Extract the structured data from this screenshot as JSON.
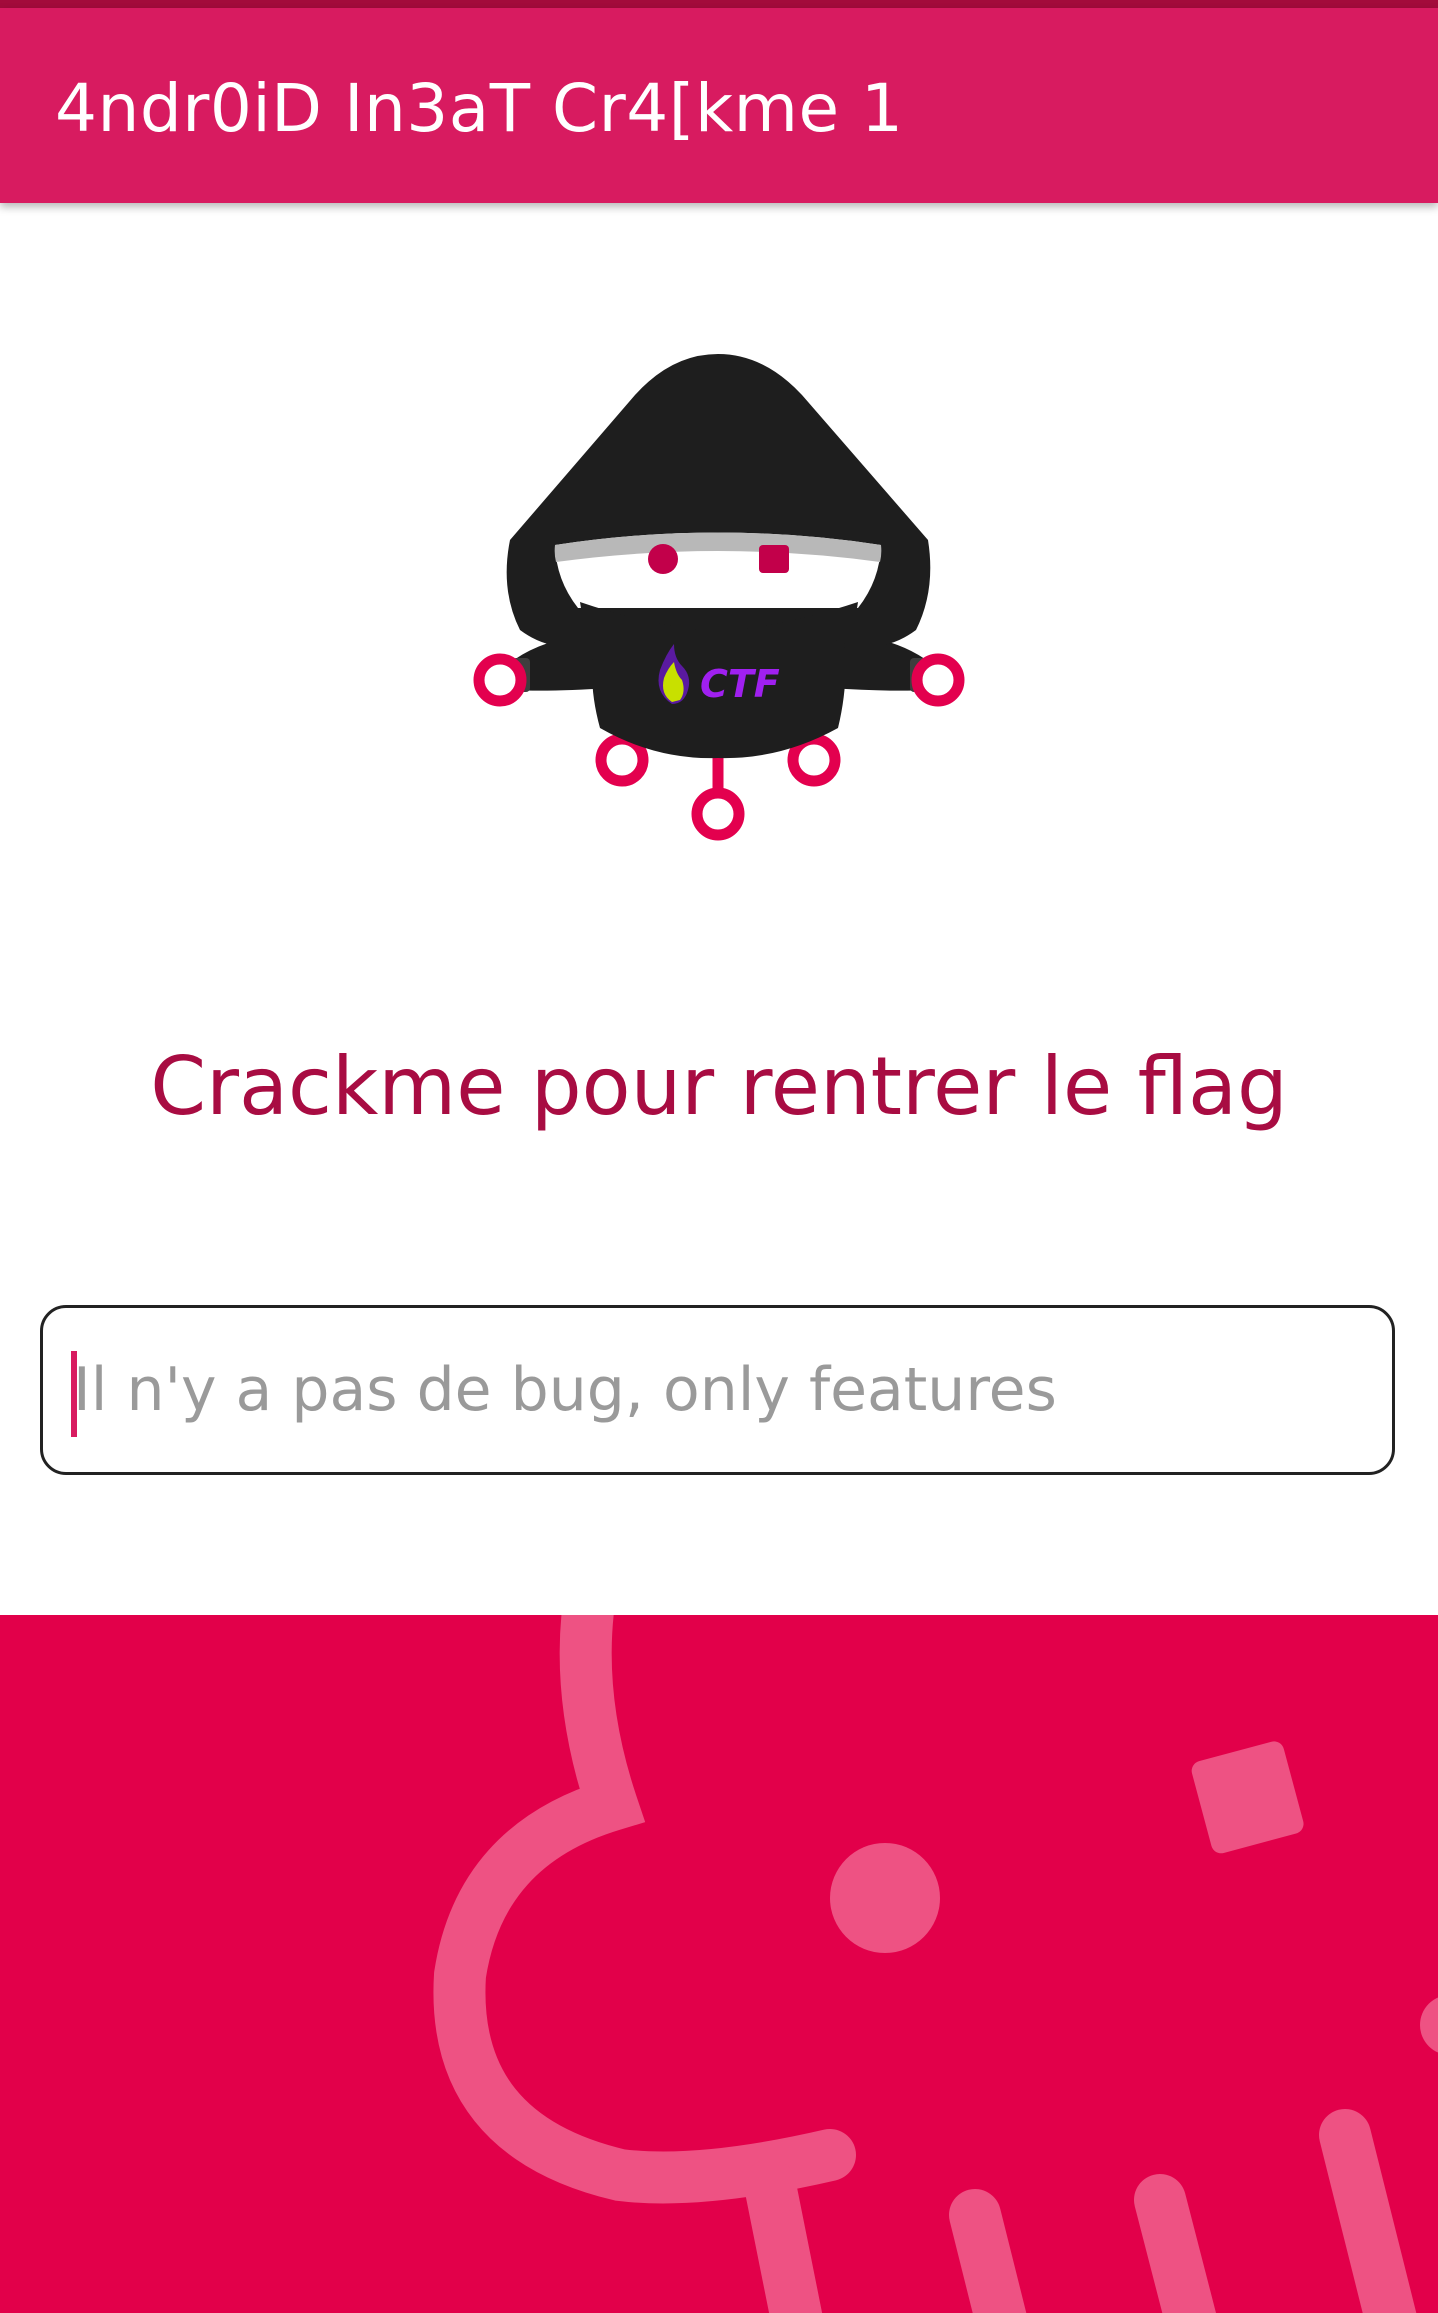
{
  "app_bar": {
    "title": "4ndr0iD In3aT Cr4[kme 1"
  },
  "logo": {
    "icon": "hooded-hacker-ctf-logo",
    "badge_text": "CTF",
    "colors": {
      "hood": "#1e1e1e",
      "accent": "#e3004e",
      "badge_text": "#a020f0",
      "flame": "#c8e000"
    }
  },
  "main": {
    "headline": "Crackme pour rentrer le flag",
    "flag_input": {
      "value": "",
      "placeholder": "Il n'y a pas de bug, only features"
    }
  },
  "banner": {
    "icon": "decorative-mascot-illustration"
  },
  "colors": {
    "app_bar": "#d81b60",
    "status_strip": "#a30b3b",
    "headline": "#a80c42",
    "banner": "#e2004a",
    "cursor": "#d81b60"
  }
}
